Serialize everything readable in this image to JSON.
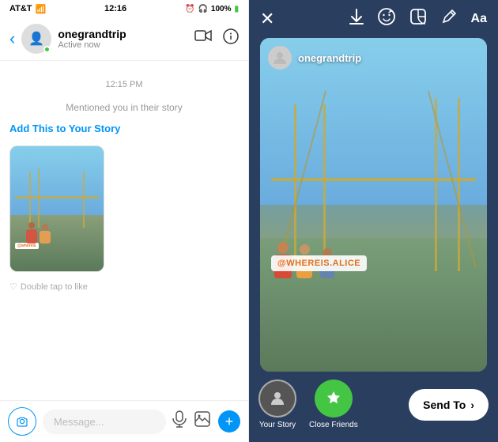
{
  "left": {
    "status": {
      "carrier": "AT&T",
      "time": "12:16",
      "battery": "100%"
    },
    "header": {
      "back": "‹",
      "username": "onegrandtrip",
      "active_status": "Active now",
      "video_icon": "▶",
      "info_icon": "ⓘ"
    },
    "messages": {
      "timestamp": "12:15 PM",
      "mention_text": "Mentioned you in their story",
      "add_story_link": "Add This to Your Story",
      "double_tap": "Double tap to like",
      "tag_text": "@whereis"
    },
    "input": {
      "placeholder": "Message...",
      "camera_icon": "📷",
      "mic_icon": "🎤",
      "gallery_icon": "🖼",
      "plus_icon": "+"
    }
  },
  "right": {
    "toolbar": {
      "close_icon": "✕",
      "download_icon": "⬇",
      "face_icon": "☺",
      "sticker_icon": "🔲",
      "draw_icon": "✏",
      "text_icon": "Aa"
    },
    "story": {
      "username": "onegrandtrip",
      "tag": "@WHEREIS.ALICE"
    },
    "bottom": {
      "your_story_label": "Your Story",
      "close_friends_label": "Close Friends",
      "send_to_label": "Send To",
      "chevron": "›"
    }
  }
}
